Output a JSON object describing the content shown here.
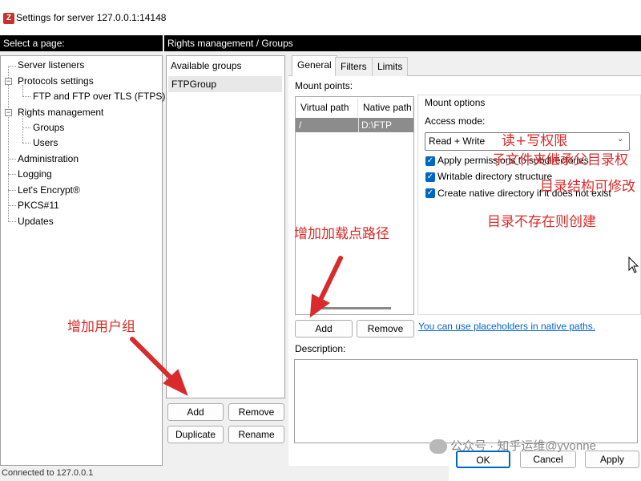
{
  "window": {
    "title": "Settings for server 127.0.0.1:14148",
    "icon": "filezilla-app-icon"
  },
  "sidebar": {
    "header": "Select a page:",
    "items": [
      "Server listeners",
      "Protocols settings",
      "FTP and FTP over TLS (FTPS)",
      "Rights management",
      "Groups",
      "Users",
      "Administration",
      "Logging",
      "Let's Encrypt®",
      "PKCS#11",
      "Updates"
    ]
  },
  "section": {
    "header": "Rights management / Groups"
  },
  "groups": {
    "column_header": "Available groups",
    "items": [
      "FTPGroup"
    ],
    "buttons": {
      "add": "Add",
      "remove": "Remove",
      "duplicate": "Duplicate",
      "rename": "Rename"
    }
  },
  "tabs": [
    "General",
    "Filters",
    "Limits"
  ],
  "mount": {
    "label": "Mount points:",
    "columns": [
      "Virtual path",
      "Native path"
    ],
    "rows": [
      {
        "virtual": "/",
        "native": "D:\\FTP"
      }
    ],
    "buttons": {
      "add": "Add",
      "remove": "Remove"
    },
    "placeholders_link": "You can use placeholders in native paths."
  },
  "mount_options": {
    "title": "Mount options",
    "access_mode_label": "Access mode:",
    "access_mode_value": "Read + Write",
    "checkboxes": [
      {
        "label": "Apply permissions to subdirectories",
        "checked": true
      },
      {
        "label": "Writable directory structure",
        "checked": true
      },
      {
        "label": "Create native directory if it does not exist",
        "checked": true
      }
    ]
  },
  "description": {
    "label": "Description:"
  },
  "dialog_buttons": {
    "ok": "OK",
    "cancel": "Cancel",
    "apply": "Apply"
  },
  "annotations": {
    "read_write": "读+写权限",
    "subdirs": "子文件夹继承父目录权",
    "writable": "目录结构可修改",
    "create_dir": "目录不存在则创建",
    "add_mount": "增加加载点路径",
    "add_group": "增加用户组"
  },
  "status_text": "Connected to 127.0.0.1",
  "watermark": "公众号 · 知乎运维@yvonne",
  "colors": {
    "annotation": "#d92b2b",
    "checkbox": "#0067c0",
    "link": "#0066cc",
    "header_bg": "#000000"
  }
}
